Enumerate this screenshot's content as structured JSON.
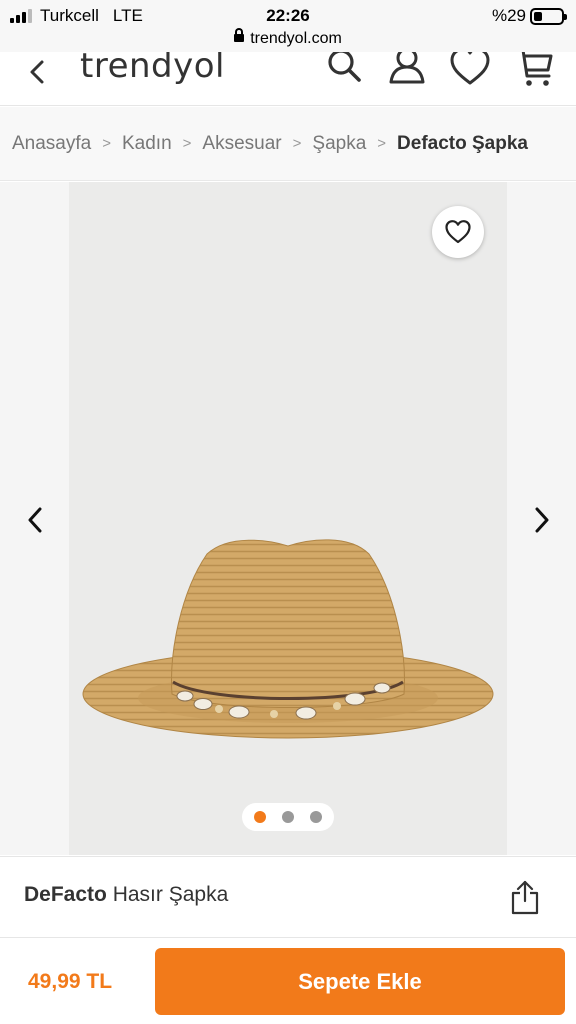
{
  "status_bar": {
    "carrier": "Turkcell",
    "network": "LTE",
    "time": "22:26",
    "battery": "%29",
    "battery_level": 0.29
  },
  "browser": {
    "url": "trendyol.com"
  },
  "header": {
    "logo": "trendyol",
    "icons": [
      "back-icon",
      "search-icon",
      "user-icon",
      "heart-icon",
      "cart-icon"
    ]
  },
  "breadcrumb": {
    "items": [
      "Anasayfa",
      "Kadın",
      "Aksesuar",
      "Şapka"
    ],
    "current": "Defacto Şapka"
  },
  "gallery": {
    "image_count": 3,
    "active_index": 0
  },
  "product": {
    "brand": "DeFacto",
    "name": "Hasır Şapka"
  },
  "purchase": {
    "price": "49,99 TL",
    "add_to_cart": "Sepete Ekle"
  },
  "colors": {
    "accent": "#f27a1a",
    "hat": "#d2a766"
  }
}
